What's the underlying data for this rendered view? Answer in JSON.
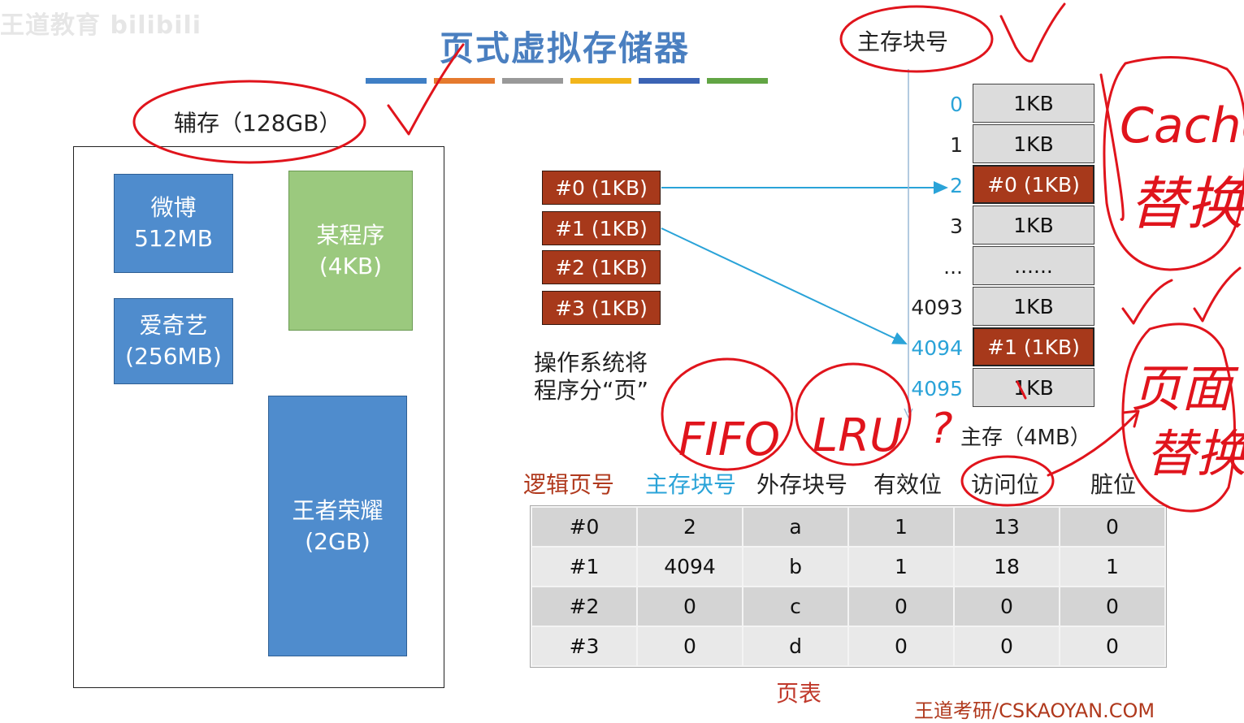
{
  "watermark": "王道教育 bilibili",
  "title": "页式虚拟存储器",
  "title_bar_colors": [
    "#3f7fc5",
    "#e57a2e",
    "#999999",
    "#f2b51b",
    "#3b63b4",
    "#62a544"
  ],
  "disk": {
    "label": "辅存（128GB）",
    "apps": [
      {
        "name": "微博",
        "size": "512MB"
      },
      {
        "name": "爱奇艺",
        "size": "(256MB)"
      },
      {
        "name": "某程序",
        "size": "(4KB)"
      },
      {
        "name": "王者荣耀",
        "size": "(2GB)"
      }
    ]
  },
  "program_pages": [
    "#0 (1KB)",
    "#1 (1KB)",
    "#2 (1KB)",
    "#3 (1KB)"
  ],
  "os_note": [
    "操作系统将",
    "程序分“页”"
  ],
  "memory": {
    "header": "主存块号",
    "frame_numbers": [
      "0",
      "1",
      "2",
      "3",
      "...",
      "4093",
      "4094",
      "4095"
    ],
    "frames": [
      "1KB",
      "1KB",
      "#0 (1KB)",
      "1KB",
      "......",
      "1KB",
      "#1 (1KB)",
      "1KB"
    ],
    "caption": "主存（4MB）"
  },
  "page_table": {
    "headers": [
      "逻辑页号",
      "主存块号",
      "外存块号",
      "有效位",
      "访问位",
      "脏位"
    ],
    "rows": [
      [
        "#0",
        "2",
        "a",
        "1",
        "13",
        "0"
      ],
      [
        "#1",
        "4094",
        "b",
        "1",
        "18",
        "1"
      ],
      [
        "#2",
        "0",
        "c",
        "0",
        "0",
        "0"
      ],
      [
        "#3",
        "0",
        "d",
        "0",
        "0",
        "0"
      ]
    ],
    "caption": "页表"
  },
  "annotations": {
    "cache": "Cache",
    "cache_replace": "替换",
    "fifo": "FIFO",
    "lru": "LRU",
    "question": "?",
    "page_replace_1": "页面",
    "page_replace_2": "替换"
  },
  "footer": "王道考研/CSKAOYAN.COM",
  "colors": {
    "page_block": "#a7391b",
    "frame": "#dcdcdc",
    "app_blue": "#4f8ccd",
    "app_green": "#9bc97e",
    "ink": "#e0141c",
    "arrow": "#2aa3d8"
  }
}
